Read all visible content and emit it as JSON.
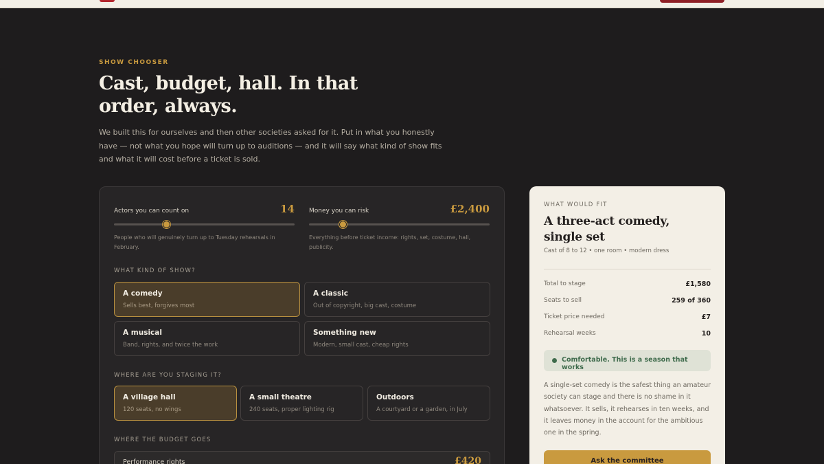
{
  "hero": {
    "eyebrow": "SHOW CHOOSER",
    "title": "Cast, budget, hall. In that order, always.",
    "description": "We built this for ourselves and then other societies asked for it. Put in what you honestly have — not what you hope will turn up to auditions — and it will say what kind of show fits and what it will cost before a ticket is sold."
  },
  "sliders": [
    {
      "label": "Actors you can count on",
      "value": "14",
      "fill": 0.29,
      "help": "People who will genuinely turn up to Tuesday rehearsals in February."
    },
    {
      "label": "Money you can risk",
      "value": "£2,400",
      "fill": 0.19,
      "help": "Everything before ticket income: rights, set, costume, hall, publicity."
    }
  ],
  "show_kind": {
    "label": "WHAT KIND OF SHOW?",
    "options": [
      {
        "title": "A comedy",
        "subtitle": "Sells best, forgives most",
        "selected": true
      },
      {
        "title": "A classic",
        "subtitle": "Out of copyright, big cast, costume",
        "selected": false
      },
      {
        "title": "A musical",
        "subtitle": "Band, rights, and twice the work",
        "selected": false
      },
      {
        "title": "Something new",
        "subtitle": "Modern, small cast, cheap rights",
        "selected": false
      }
    ]
  },
  "venue": {
    "label": "WHERE ARE YOU STAGING IT?",
    "options": [
      {
        "title": "A village hall",
        "subtitle": "120 seats, no wings",
        "selected": true
      },
      {
        "title": "A small theatre",
        "subtitle": "240 seats, proper lighting rig",
        "selected": false
      },
      {
        "title": "Outdoors",
        "subtitle": "A courtyard or a garden, in July",
        "selected": false
      }
    ]
  },
  "budget": {
    "label": "WHERE THE BUDGET GOES",
    "rows": [
      {
        "label": "Performance rights",
        "value": "£420"
      }
    ]
  },
  "result": {
    "eyebrow": "WHAT WOULD FIT",
    "title": "A three-act comedy, single set",
    "subtitle": "Cast of 8 to 12 • one room • modern dress",
    "stats": [
      {
        "label": "Total to stage",
        "value": "£1,580"
      },
      {
        "label": "Seats to sell",
        "value": "259 of 360"
      },
      {
        "label": "Ticket price needed",
        "value": "£7"
      },
      {
        "label": "Rehearsal weeks",
        "value": "10"
      }
    ],
    "status": "Comfortable. This is a season that works",
    "body": "A single-set comedy is the safest thing an amateur society can stage and there is no shame in it whatsoever. It sells, it rehearses in ten weeks, and it leaves money in the account for the ambitious one in the spring.",
    "cta": "Ask the committee"
  },
  "colors": {
    "accent": "#c99a3f",
    "background": "#1e1c1d",
    "panel": "#272526",
    "result_bg": "#f3efe6",
    "status_green": "#3f6b4c",
    "brand_red": "#b3262d"
  }
}
